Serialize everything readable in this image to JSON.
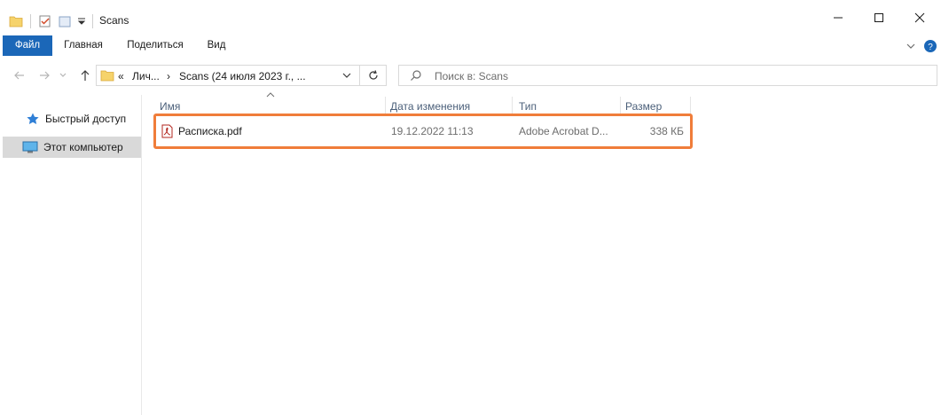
{
  "window": {
    "title": "Scans",
    "minimize_icon": "minimize-icon",
    "maximize_icon": "maximize-icon",
    "close_icon": "close-icon"
  },
  "ribbon": {
    "tabs": [
      {
        "label": "Файл"
      },
      {
        "label": "Главная"
      },
      {
        "label": "Поделиться"
      },
      {
        "label": "Вид"
      }
    ]
  },
  "address": {
    "segments": [
      "«",
      "Лич...",
      "›",
      "Scans (24 июля 2023 г., ..."
    ],
    "search_placeholder": "Поиск в: Scans"
  },
  "sidebar": {
    "items": [
      {
        "label": "Быстрый доступ",
        "icon": "star-icon"
      },
      {
        "label": "Этот компьютер",
        "icon": "computer-icon"
      }
    ]
  },
  "columns": [
    {
      "label": "Имя"
    },
    {
      "label": "Дата изменения"
    },
    {
      "label": "Тип"
    },
    {
      "label": "Размер"
    }
  ],
  "files": [
    {
      "name": "Расписка.pdf",
      "modified": "19.12.2022 11:13",
      "type": "Adobe Acrobat D...",
      "size": "338 КБ",
      "icon": "pdf-icon"
    }
  ],
  "colors": {
    "file_tab": "#1b67b8",
    "highlight": "#f07d3a",
    "selected_sidebar": "#d9d9d9"
  }
}
